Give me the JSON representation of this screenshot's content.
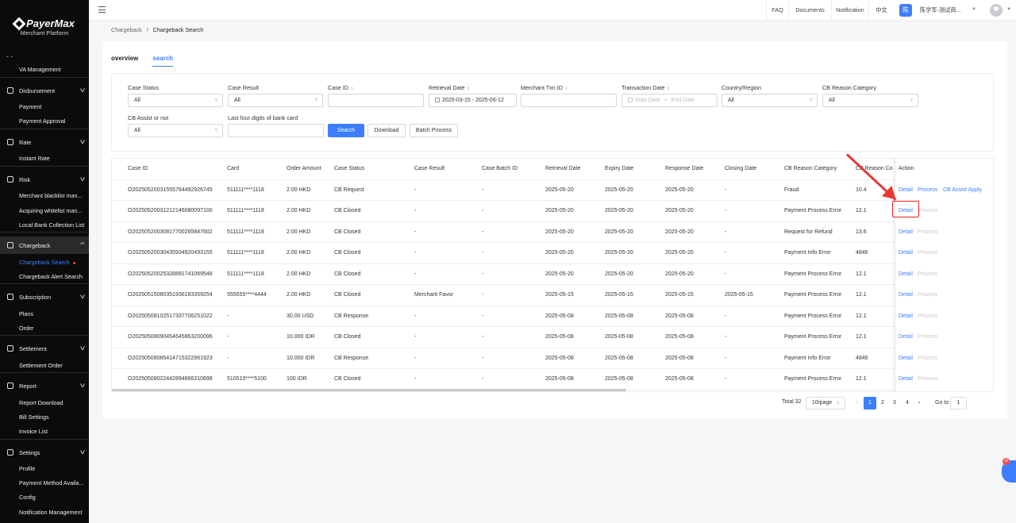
{
  "brand": {
    "name": "PayerMax",
    "sub": "Merchant  Platform"
  },
  "sidebar": {
    "dash": "- -",
    "va": "VA Management",
    "groups": [
      {
        "label": "Disbursement",
        "items": [
          "Payment",
          "Payment Approval"
        ]
      },
      {
        "label": "Rate",
        "items": [
          "Instant Rate"
        ]
      },
      {
        "label": "Risk",
        "items": [
          "Merchant blacklist man...",
          "Acquiring whitelist man...",
          "Local Bank Collection List"
        ]
      },
      {
        "label": "Chargeback",
        "items": [
          "Chargeback Search",
          "Chargeback Alert Search"
        ]
      },
      {
        "label": "Subscription",
        "items": [
          "Plans",
          "Order"
        ]
      },
      {
        "label": "Settlement",
        "items": [
          "Settlement Order"
        ]
      },
      {
        "label": "Report",
        "items": [
          "Report Download",
          "Bill Settings",
          "Invoice List"
        ]
      },
      {
        "label": "Settings",
        "items": [
          "Profile",
          "Payment Method Availa...",
          "Config",
          "Notification Management"
        ]
      }
    ]
  },
  "topbar": {
    "links": [
      "FAQ",
      "Documents",
      "Notification",
      "中文"
    ],
    "badge": "陈",
    "user": "陈学军-测试商..."
  },
  "breadcrumb": {
    "parent": "Chargeback",
    "sep": "/",
    "current": "Chargeback Search"
  },
  "tabs": [
    "overview",
    "search"
  ],
  "filters": {
    "case_status": {
      "label": "Case Status",
      "value": "All"
    },
    "case_result": {
      "label": "Case Result",
      "value": "All"
    },
    "case_id": {
      "label": "Case ID",
      "value": ""
    },
    "retrieval_date": {
      "label": "Retrieval Date",
      "value": "2025-03-15 - 2025-06-12"
    },
    "merchant_txn_id": {
      "label": "Merchant Txn ID",
      "value": ""
    },
    "transaction_date": {
      "label": "Transaction Date",
      "start_ph": "Start Date",
      "dash": "-",
      "end_ph": "End Date"
    },
    "country_region": {
      "label": "Country/Region",
      "value": "All"
    },
    "cb_reason_category": {
      "label": "CB Reason Category",
      "value": "All"
    },
    "cb_assist": {
      "label": "CB Assist or not",
      "value": "All"
    },
    "last_four": {
      "label": "Last four digits of bank card",
      "value": ""
    },
    "buttons": {
      "search": "Search",
      "download": "Download",
      "batch": "Batch Process"
    }
  },
  "table": {
    "columns": [
      "Case ID",
      "Card",
      "Order Amount",
      "Case Status",
      "Case Result",
      "Case Batch ID",
      "Retrieval Date",
      "Expiry Date",
      "Response Date",
      "Closing Date",
      "CB Reason Category",
      "CB Reason Co",
      "Action"
    ],
    "rows": [
      [
        "O2025052003155576449292674​5",
        "511111****1118",
        "2.00 HKD",
        "CB Request",
        "-",
        "-",
        "2025-05-20",
        "2025-05-20",
        "2025-05-20",
        "-",
        "Fraud",
        "10.4"
      ],
      [
        "O2025052003121214608009710​0",
        "511111****1118",
        "2.00 HKD",
        "CB Closed",
        "-",
        "-",
        "2025-05-20",
        "2025-05-20",
        "2025-05-20",
        "-",
        "Payment Process Error",
        "12.1"
      ],
      [
        "O2025052003081770026584760​2",
        "511111****1118",
        "2.00 HKD",
        "CB Closed",
        "-",
        "-",
        "2025-05-20",
        "2025-05-20",
        "2025-05-20",
        "-",
        "Request for Refund",
        "13.6"
      ],
      [
        "O2025052003043593492049315​5",
        "511111****1118",
        "2.00 HKD",
        "CB Closed",
        "-",
        "-",
        "2025-05-20",
        "2025-05-20",
        "2025-05-20",
        "-",
        "Payment Info Error",
        "4846"
      ],
      [
        "O2025052002532889174106954​8",
        "511111****1118",
        "2.00 HKD",
        "CB Closed",
        "-",
        "-",
        "2025-05-20",
        "2025-05-20",
        "2025-05-20",
        "-",
        "Payment Process Error",
        "12.1"
      ],
      [
        "O2025051508035193618335925​4",
        "555555****4444",
        "2.00 HKD",
        "CB Closed",
        "Merchant Favor",
        "-",
        "2025-05-15",
        "2025-05-15",
        "2025-05-15",
        "2025-05-15",
        "Payment Process Error",
        "12.1"
      ],
      [
        "O2025050810251733770625102​2",
        "-",
        "30.00 USD",
        "CB Response",
        "-",
        "-",
        "2025-05-08",
        "2025-05-08",
        "2025-05-08",
        "-",
        "Payment Process Error",
        "12.1"
      ],
      [
        "O2025050809045464586320009​6",
        "-",
        "10.000 IDR",
        "CB Closed",
        "-",
        "-",
        "2025-05-08",
        "2025-05-08",
        "2025-05-08",
        "-",
        "Payment Process Error",
        "12.1"
      ],
      [
        "O2025050808541471532296192​3",
        "-",
        "10.000 IDR",
        "CB Response",
        "-",
        "-",
        "2025-05-08",
        "2025-05-08",
        "2025-05-08",
        "-",
        "Payment Info Error",
        "4846"
      ],
      [
        "O2025050802244289466631069​8",
        "510510****5100",
        "100 IDR",
        "CB Closed",
        "-",
        "-",
        "2025-05-08",
        "2025-05-08",
        "2025-05-08",
        "-",
        "Payment Process Error",
        "12.1"
      ]
    ],
    "actions": {
      "detail": "Detail",
      "process": "Process",
      "assist": "CB Assist Apply"
    }
  },
  "pagination": {
    "total": "Total 32",
    "page_size": "10/page",
    "pages": [
      "1",
      "2",
      "3",
      "4"
    ],
    "goto_label": "Go to",
    "goto_value": "1",
    "prev": "‹",
    "next": "›"
  },
  "chat": {
    "badge": "10"
  },
  "colors": {
    "accent": "#3d7eff",
    "annotation": "#e53935",
    "sidebar": "#0b0b0c"
  }
}
